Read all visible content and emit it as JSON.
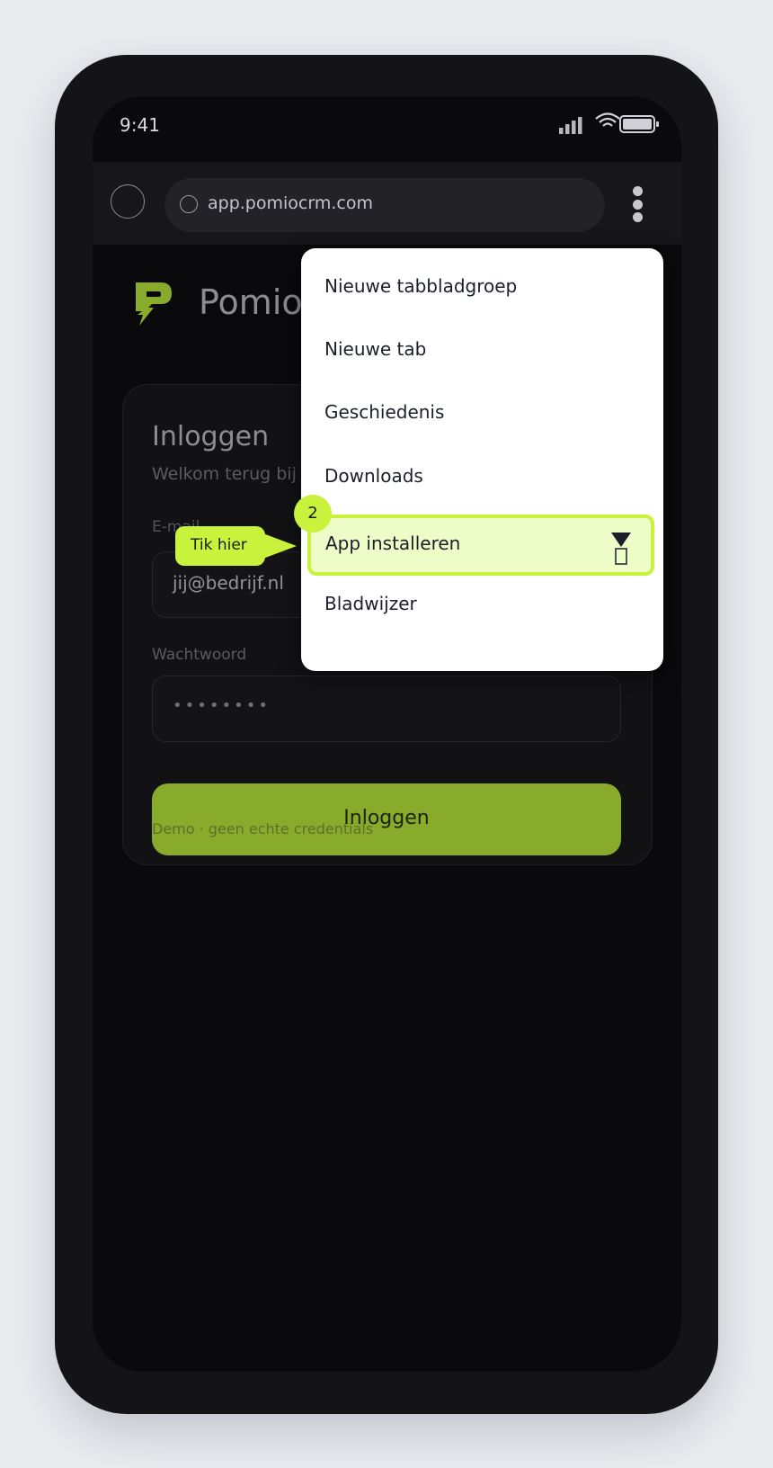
{
  "statusbar": {
    "time": "9:41"
  },
  "browser": {
    "url": "app.pomiocrm.com"
  },
  "brand": {
    "name": "Pomio",
    "accent": "#89ab2c"
  },
  "login": {
    "title": "Inloggen",
    "subtitle": "Welkom terug bij",
    "email_label": "E-mail",
    "email_value": "jij@bedrijf.nl",
    "password_label": "Wachtwoord",
    "password_value": "••••••••",
    "button_label": "Inloggen",
    "demo_note": "Demo · geen echte credentials"
  },
  "menu": {
    "items": [
      {
        "label": "Nieuwe tabbladgroep"
      },
      {
        "label": "Nieuwe tab"
      },
      {
        "label": "Geschiedenis"
      },
      {
        "label": "Downloads"
      },
      {
        "label": "App installeren",
        "icon": "install-app-icon",
        "highlighted": true
      },
      {
        "label": "Bladwijzer"
      }
    ]
  },
  "guide": {
    "step": "2",
    "hint": "Tik hier",
    "color": "#c8f23b"
  }
}
